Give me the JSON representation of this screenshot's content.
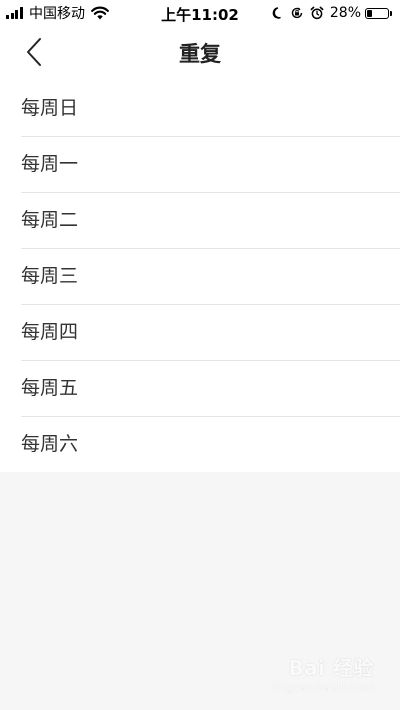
{
  "status_bar": {
    "carrier": "中国移动",
    "time": "上午11:02",
    "battery_percent": "28%",
    "battery_level": 0.28,
    "icons": [
      "signal-bars-icon",
      "wifi-icon",
      "moon-icon",
      "rotation-lock-icon",
      "alarm-icon",
      "battery-icon"
    ]
  },
  "nav": {
    "title": "重复",
    "back_icon": "chevron-left-icon"
  },
  "list": {
    "items": [
      {
        "label": "每周日"
      },
      {
        "label": "每周一"
      },
      {
        "label": "每周二"
      },
      {
        "label": "每周三"
      },
      {
        "label": "每周四"
      },
      {
        "label": "每周五"
      },
      {
        "label": "每周六"
      }
    ]
  },
  "watermark": {
    "brand": "Bai 经验",
    "url": "jingyan.baidu.com"
  },
  "colors": {
    "background": "#f6f6f6",
    "surface": "#ffffff",
    "divider": "#e4e4e4",
    "text_primary": "#222222"
  }
}
